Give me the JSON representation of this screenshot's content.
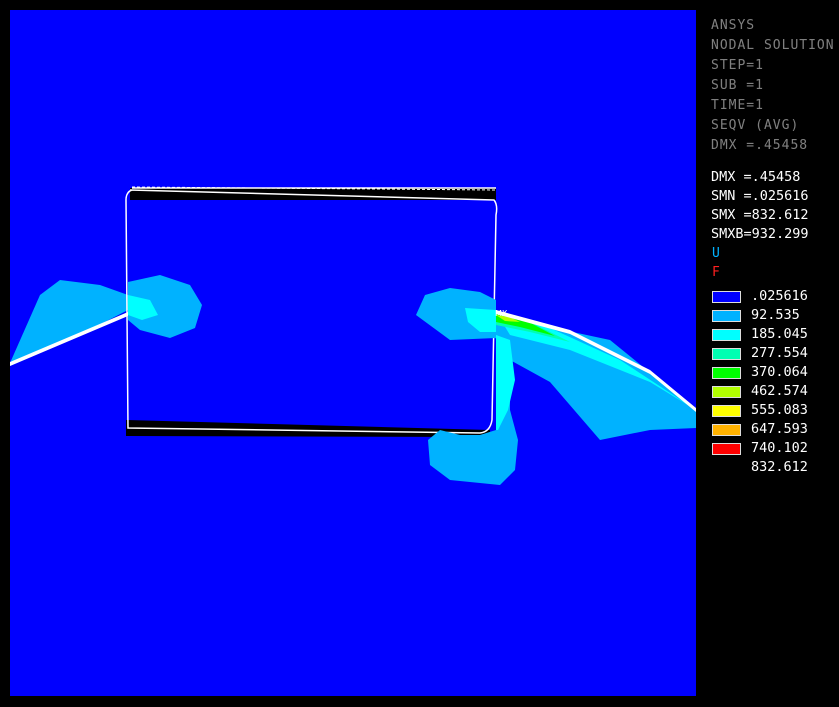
{
  "legend": {
    "header_lines": [
      "ANSYS",
      "NODAL SOLUTION",
      "STEP=1",
      "SUB =1",
      "TIME=1",
      "SEQV (AVG)",
      "DMX =.45458"
    ],
    "results": [
      {
        "label": "DMX =",
        "value": ".45458"
      },
      {
        "label": "SMN =",
        "value": ".025616"
      },
      {
        "label": "SMX =",
        "value": "832.612"
      },
      {
        "label": "SMXB=",
        "value": "932.299"
      }
    ],
    "u_label": "U",
    "f_label": "F",
    "bands": [
      {
        "value": ".025616",
        "color": "#0000ff"
      },
      {
        "value": "92.535",
        "color": "#00b2ff"
      },
      {
        "value": "185.045",
        "color": "#00ffff"
      },
      {
        "value": "277.554",
        "color": "#00ffb2"
      },
      {
        "value": "370.064",
        "color": "#00ff00"
      },
      {
        "value": "462.574",
        "color": "#b2ff00"
      },
      {
        "value": "555.083",
        "color": "#ffff00"
      },
      {
        "value": "647.593",
        "color": "#ffb200"
      },
      {
        "value": "740.102",
        "color": "#ff0000"
      },
      {
        "value": "832.612",
        "color": "#ff0000"
      }
    ]
  },
  "plot": {
    "max_marker": "MX",
    "colors": {
      "background": "#0000ff",
      "level1": "#00b2ff",
      "level2": "#00ffff",
      "level3": "#00ffb2",
      "level4": "#00ff00",
      "outline": "#ffffff"
    }
  }
}
